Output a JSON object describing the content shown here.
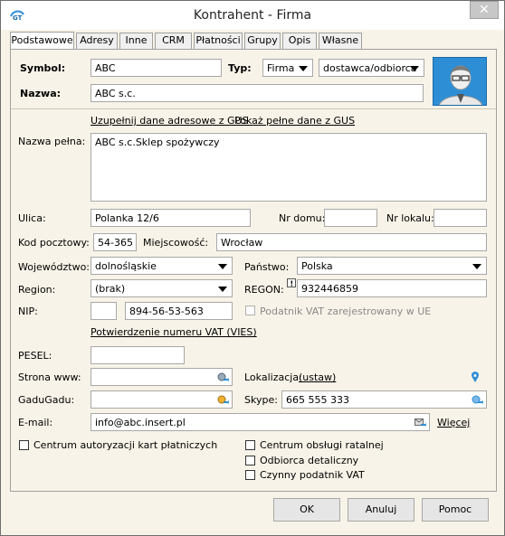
{
  "window": {
    "title": "Kontrahent - Firma",
    "close": "✕"
  },
  "tabs": [
    "Podstawowe",
    "Adresy",
    "Inne",
    "CRM",
    "Płatności",
    "Grupy",
    "Opis",
    "Własne"
  ],
  "header": {
    "symbol_label": "Symbol:",
    "symbol_value": "ABC",
    "typ_label": "Typ:",
    "typ_value": "Firma",
    "kind_value": "dostawca/odbiorca",
    "nazwa_label": "Nazwa:",
    "nazwa_value": "ABC s.c."
  },
  "gus": {
    "fill_link": "Uzupełnij dane adresowe z GUS",
    "show_link": "Pokaż pełne dane z GUS"
  },
  "address": {
    "full_name_label": "Nazwa pełna:",
    "full_name_value": "ABC s.c.Sklep spożywczy",
    "street_label": "Ulica:",
    "street_value": "Polanka  12/6",
    "house_label": "Nr domu:",
    "house_value": "",
    "flat_label": "Nr lokalu:",
    "flat_value": "",
    "postal_label": "Kod pocztowy:",
    "postal_value": "54-365",
    "city_label": "Miejscowość:",
    "city_value": "Wrocław",
    "voivodeship_label": "Województwo:",
    "voivodeship_value": "dolnośląskie",
    "country_label": "Państwo:",
    "country_value": "Polska",
    "region_label": "Region:",
    "region_value": "(brak)",
    "regon_label": "REGON:",
    "regon_value": "932446859",
    "nip_label": "NIP:",
    "nip_prefix": "",
    "nip_value": "894-56-53-563",
    "vat_ue_label": "Podatnik VAT zarejestrowany w UE",
    "vies_link": "Potwierdzenie numeru VAT (VIES)"
  },
  "contact": {
    "pesel_label": "PESEL:",
    "pesel_value": "",
    "www_label": "Strona www:",
    "www_value": "",
    "location_label": "Lokalizacja:",
    "location_link": "(ustaw)",
    "gadu_label": "GaduGadu:",
    "gadu_value": "",
    "skype_label": "Skype:",
    "skype_value": "665 555 333",
    "email_label": "E-mail:",
    "email_value": "info@abc.insert.pl",
    "more_link": "Więcej"
  },
  "options": {
    "card_center": "Centrum autoryzacji kart płatniczych",
    "installment_center": "Centrum obsługi ratalnej",
    "retail_receiver": "Odbiorca detaliczny",
    "active_vat": "Czynny podatnik VAT"
  },
  "buttons": {
    "ok": "OK",
    "cancel": "Anuluj",
    "help": "Pomoc"
  },
  "colors": {
    "background": "#f8f3e8",
    "avatar": "#2d8ed6"
  }
}
